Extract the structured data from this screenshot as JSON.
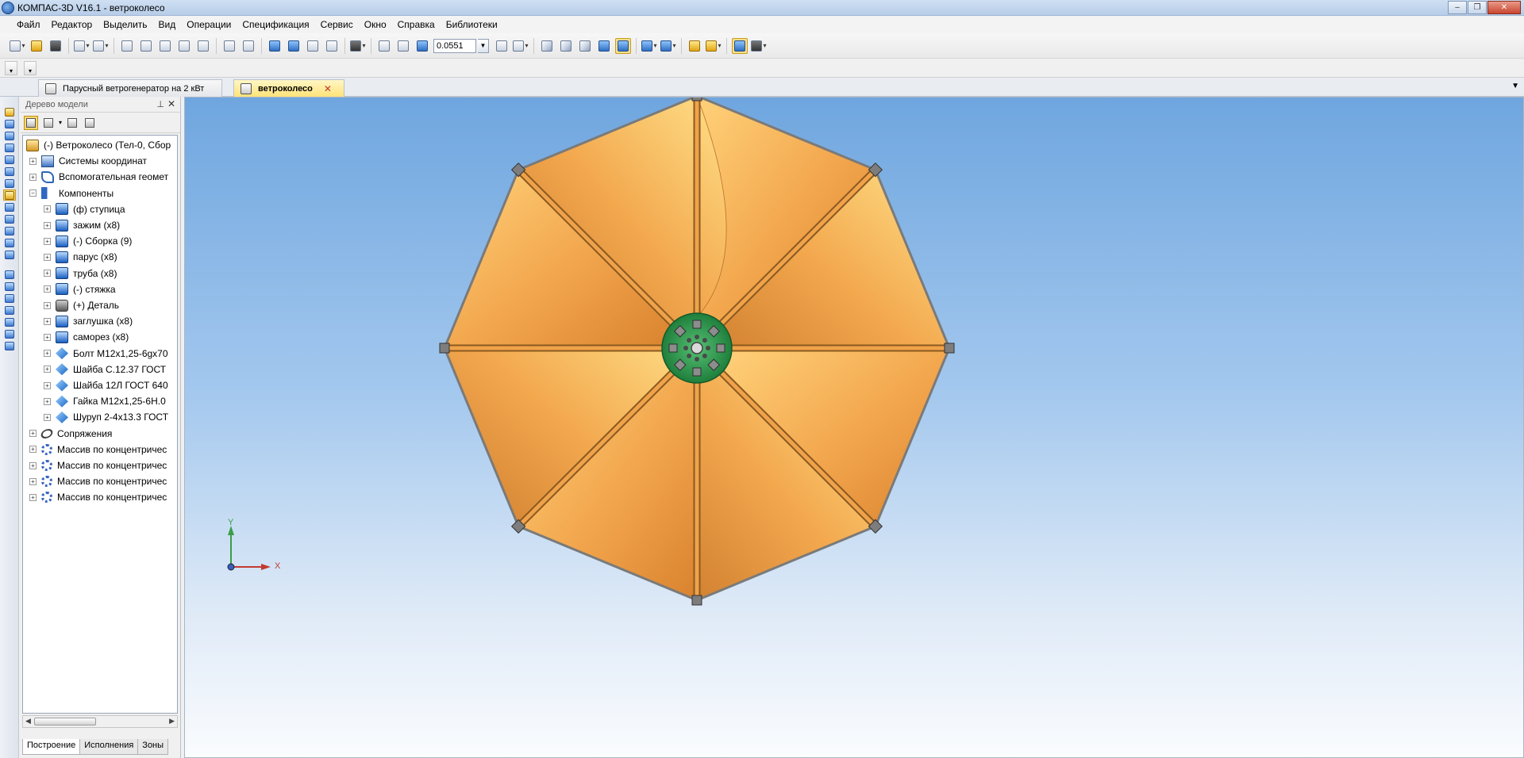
{
  "window": {
    "title": "КОМПАС-3D V16.1 - ветроколесо",
    "buttons": [
      "–",
      "❐",
      "✕"
    ]
  },
  "menu": [
    "Файл",
    "Редактор",
    "Выделить",
    "Вид",
    "Операции",
    "Спецификация",
    "Сервис",
    "Окно",
    "Справка",
    "Библиотеки"
  ],
  "toolbar": {
    "zoom_value": "0.0551"
  },
  "tabs": [
    {
      "label": "Парусный ветрогенератор на 2 кВт",
      "active": false
    },
    {
      "label": "ветроколесо",
      "active": true,
      "close": "✕"
    }
  ],
  "tree_panel": {
    "title": "Дерево модели",
    "pin": "⊥",
    "close": "✕",
    "items": [
      {
        "label": "(-) Ветроколесо (Тел-0, Сбор",
        "icon": "assembly-icon",
        "level": 0,
        "expander": ""
      },
      {
        "label": "Системы координат",
        "icon": "coordinate-systems-icon",
        "level": 1,
        "expander": "+"
      },
      {
        "label": "Вспомогательная геомет",
        "icon": "auxiliary-geometry-icon",
        "level": 1,
        "expander": "+"
      },
      {
        "label": "Компоненты",
        "icon": "components-icon",
        "level": 1,
        "expander": "−"
      },
      {
        "label": "(ф) ступица",
        "icon": "part-icon",
        "level": 2,
        "expander": "+"
      },
      {
        "label": "зажим (х8)",
        "icon": "part-icon",
        "level": 2,
        "expander": "+"
      },
      {
        "label": "(-) Сборка (9)",
        "icon": "part-icon",
        "level": 2,
        "expander": "+"
      },
      {
        "label": "парус (х8)",
        "icon": "part-icon",
        "level": 2,
        "expander": "+"
      },
      {
        "label": "труба (х8)",
        "icon": "part-icon",
        "level": 2,
        "expander": "+"
      },
      {
        "label": "(-) стяжка",
        "icon": "part-icon",
        "level": 2,
        "expander": "+"
      },
      {
        "label": "(+) Деталь",
        "icon": "detail-icon",
        "level": 2,
        "expander": "+"
      },
      {
        "label": "заглушка (х8)",
        "icon": "part-icon",
        "level": 2,
        "expander": "+"
      },
      {
        "label": "саморез (х8)",
        "icon": "part-icon",
        "level": 2,
        "expander": "+"
      },
      {
        "label": "Болт М12х1,25-6gх70",
        "icon": "standard-part-icon",
        "level": 2,
        "expander": "+"
      },
      {
        "label": "Шайба С.12.37 ГОСТ",
        "icon": "standard-part-icon",
        "level": 2,
        "expander": "+"
      },
      {
        "label": "Шайба 12Л ГОСТ 640",
        "icon": "standard-part-icon",
        "level": 2,
        "expander": "+"
      },
      {
        "label": "Гайка М12х1,25-6Н.0",
        "icon": "standard-part-icon",
        "level": 2,
        "expander": "+"
      },
      {
        "label": "Шуруп 2-4х13.3 ГОСТ",
        "icon": "standard-part-icon",
        "level": 2,
        "expander": "+"
      },
      {
        "label": "Сопряжения",
        "icon": "mates-icon",
        "level": 1,
        "expander": "+"
      },
      {
        "label": "Массив по концентричес",
        "icon": "circular-array-icon",
        "level": 1,
        "expander": "+"
      },
      {
        "label": "Массив по концентричес",
        "icon": "circular-array-icon",
        "level": 1,
        "expander": "+"
      },
      {
        "label": "Массив по концентричес",
        "icon": "circular-array-icon",
        "level": 1,
        "expander": "+"
      },
      {
        "label": "Массив по концентричес",
        "icon": "circular-array-icon",
        "level": 1,
        "expander": "+"
      }
    ],
    "bottom_tabs": [
      "Построение",
      "Исполнения",
      "Зоны"
    ]
  },
  "viewport": {
    "axis_x": "X",
    "axis_y": "Y",
    "colors": {
      "sail": "#f0a24a",
      "sail_highlight": "#ffd27a",
      "hub": "#2e9a4f",
      "frame": "#6a6a6a"
    }
  }
}
